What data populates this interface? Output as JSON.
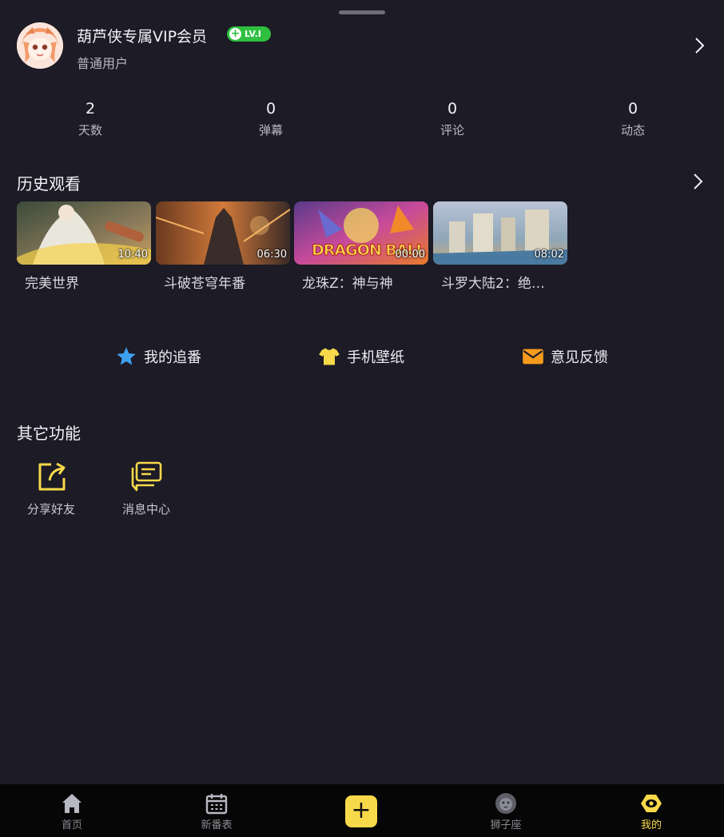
{
  "profile": {
    "name": "葫芦侠专属VIP会员",
    "level": "LV.I",
    "user_type": "普通用户"
  },
  "stats": [
    {
      "value": "2",
      "label": "天数"
    },
    {
      "value": "0",
      "label": "弹幕"
    },
    {
      "value": "0",
      "label": "评论"
    },
    {
      "value": "0",
      "label": "动态"
    }
  ],
  "history": {
    "title": "历史观看",
    "items": [
      {
        "title": "完美世界",
        "duration": "10:40"
      },
      {
        "title": "斗破苍穹年番",
        "duration": "06:30"
      },
      {
        "title": "龙珠Z：神与神",
        "duration": "00:00",
        "overlay": "DRAGON BALL Z"
      },
      {
        "title": "斗罗大陆2：绝…",
        "duration": "08:02"
      }
    ]
  },
  "quick": [
    {
      "label": "我的追番",
      "icon": "star-icon",
      "color": "#3fa0f0"
    },
    {
      "label": "手机壁纸",
      "icon": "tshirt-icon",
      "color": "#f7d94a"
    },
    {
      "label": "意见反馈",
      "icon": "mail-icon",
      "color": "#f59b1c"
    }
  ],
  "other": {
    "title": "其它功能",
    "items": [
      {
        "label": "分享好友",
        "icon": "share-icon"
      },
      {
        "label": "消息中心",
        "icon": "message-icon"
      }
    ]
  },
  "tabs": [
    {
      "label": "首页",
      "icon": "home-icon"
    },
    {
      "label": "新番表",
      "icon": "calendar-icon"
    },
    {
      "label": "",
      "icon": "add-icon"
    },
    {
      "label": "狮子座",
      "icon": "lion-icon"
    },
    {
      "label": "我的",
      "icon": "profile-icon",
      "active": true
    }
  ],
  "colors": {
    "background": "#1c1b26",
    "accent": "#f7d94a",
    "level_badge": "#2fbf3f"
  }
}
